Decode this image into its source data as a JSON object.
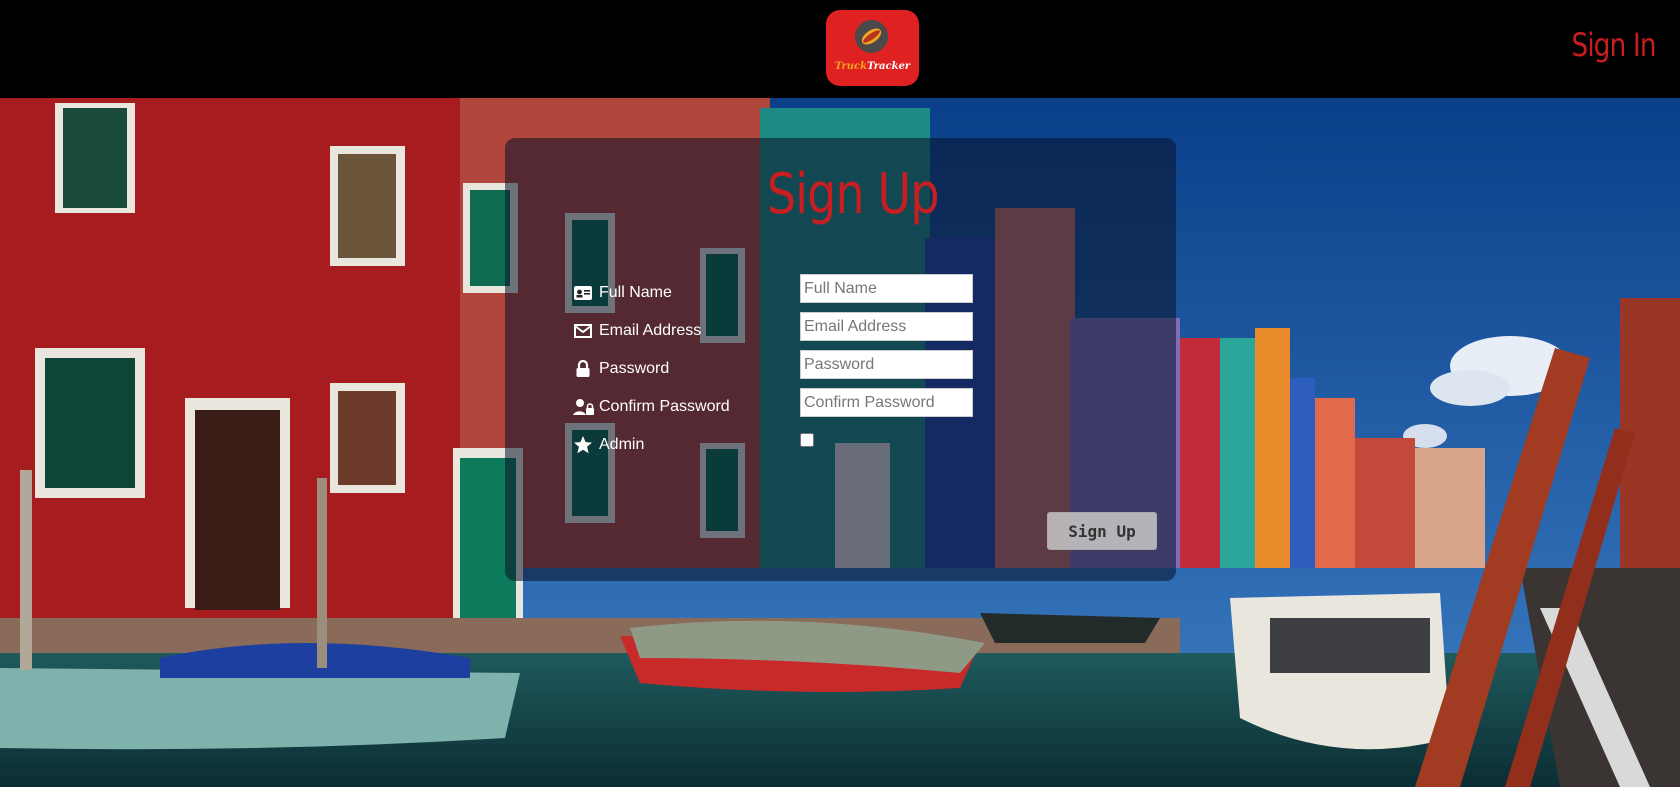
{
  "header": {
    "logo": {
      "word1": "Truck",
      "word2": "Tracker",
      "icon": "hotdog-icon"
    },
    "signin_label": "Sign In"
  },
  "form": {
    "title": "Sign Up",
    "fields": [
      {
        "label": "Full Name",
        "placeholder": "Full Name",
        "icon": "id-card-icon"
      },
      {
        "label": "Email Address",
        "placeholder": "Email Address",
        "icon": "envelope-icon"
      },
      {
        "label": "Password",
        "placeholder": "Password",
        "icon": "lock-icon"
      },
      {
        "label": "Confirm Password",
        "placeholder": "Confirm Password",
        "icon": "user-lock-icon"
      }
    ],
    "admin": {
      "label": "Admin",
      "icon": "star-icon",
      "checked": false
    },
    "submit_label": "Sign Up"
  },
  "colors": {
    "accent": "#c81e22",
    "logo_bg": "#df2121",
    "header_bg": "#000000"
  }
}
